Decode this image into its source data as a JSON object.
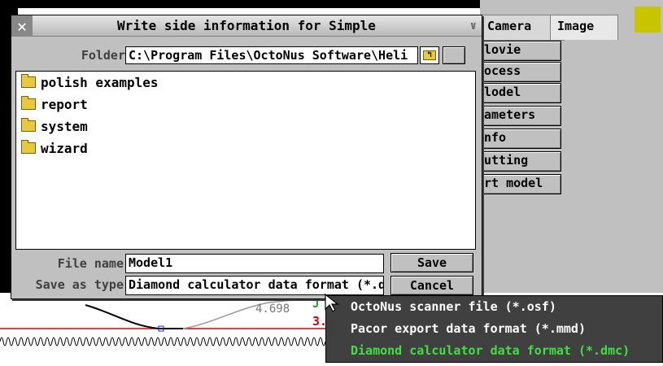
{
  "dialog": {
    "title": "Write side information for Simple",
    "close_icon": "close-icon",
    "folder_label": "Folder",
    "folder_path": "C:\\Program Files\\OctoNus Software\\Heli",
    "items": [
      {
        "name": "polish examples",
        "icon": "folder-icon"
      },
      {
        "name": "report",
        "icon": "folder-icon"
      },
      {
        "name": "system",
        "icon": "folder-icon"
      },
      {
        "name": "wizard",
        "icon": "folder-icon"
      }
    ],
    "file_name_label": "File name",
    "file_name_value": "Model1",
    "save_as_type_label": "Save as type",
    "save_as_type_value": "Diamond calculator data format (*.d",
    "save_label": "Save",
    "cancel_label": "Cancel"
  },
  "right_panel": {
    "tabs": [
      "Camera",
      "Image"
    ],
    "menu": [
      "lovie",
      "ocess",
      "lodel",
      "ameters",
      "nfo",
      "utting",
      "rt model"
    ],
    "swatch_color": "#c8c400"
  },
  "graph": {
    "value_label": "4.698",
    "marker_text_green": "J",
    "marker_text_red": "3."
  },
  "dropdown": {
    "options": [
      "OctoNus scanner file (*.osf)",
      "Pacor export data format (*.mmd)",
      "Diamond calculator data format (*.dmc)"
    ],
    "selected_index": 2
  }
}
